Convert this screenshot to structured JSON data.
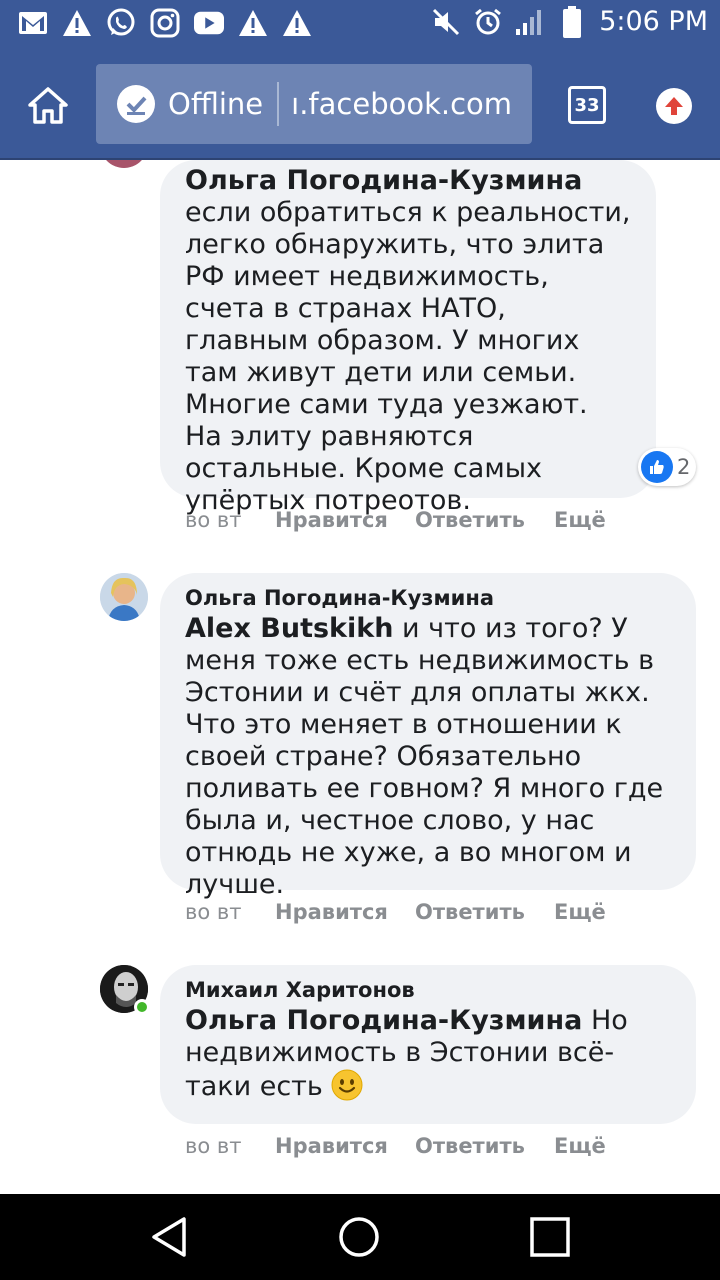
{
  "status_bar": {
    "time": "5:06 PM",
    "left_icons": [
      "gmail-icon",
      "warning-icon",
      "whatsapp-icon",
      "instagram-icon",
      "youtube-icon",
      "warning-icon",
      "warning-icon"
    ],
    "right_icons": [
      "mute-icon",
      "alarm-icon",
      "signal-icon",
      "battery-icon"
    ]
  },
  "browser": {
    "offline_label": "Offline",
    "url": "ı.facebook.com",
    "tab_count": "33"
  },
  "comments": [
    {
      "author": "",
      "mention": "Ольга Погодина-Кузмина",
      "text": " если обратиться к реальности, легко обнаружить, что элита РФ имеет недвижимость, счета в странах НАТО, главным образом. У многих там живут дети или семьи. Многие сами туда уезжают. На элиту равняются остальные. Кроме самых упёртых потреотов.",
      "reaction_count": "2",
      "time": "во вт",
      "like_label": "Нравится",
      "reply_label": "Ответить",
      "more_label": "Ещё"
    },
    {
      "author": "Ольга Погодина-Кузмина",
      "mention": "Alex Butskikh",
      "text": " и что из того? У меня тоже есть недвижимость в Эстонии и счёт для оплаты жкх. Что это меняет в отношении к своей стране? Обязательно поливать ее говном? Я много где была и, честное слово, у нас отнюдь не хуже, а во многом и лучше.",
      "time": "во вт",
      "like_label": "Нравится",
      "reply_label": "Ответить",
      "more_label": "Ещё"
    },
    {
      "author": "Михаил Харитонов",
      "mention": "Ольга Погодина-Кузмина",
      "text": " Но недвижимость в Эстонии всё-таки есть ",
      "emoji": "smile-emoji",
      "time": "во вт",
      "like_label": "Нравится",
      "reply_label": "Ответить",
      "more_label": "Ещё"
    }
  ],
  "nav": [
    "back-icon",
    "home-icon",
    "recents-icon"
  ],
  "colors": {
    "brand": "#3b5998",
    "bubble": "#f0f2f5",
    "like_blue": "#1877f2",
    "online_green": "#42b72a"
  }
}
